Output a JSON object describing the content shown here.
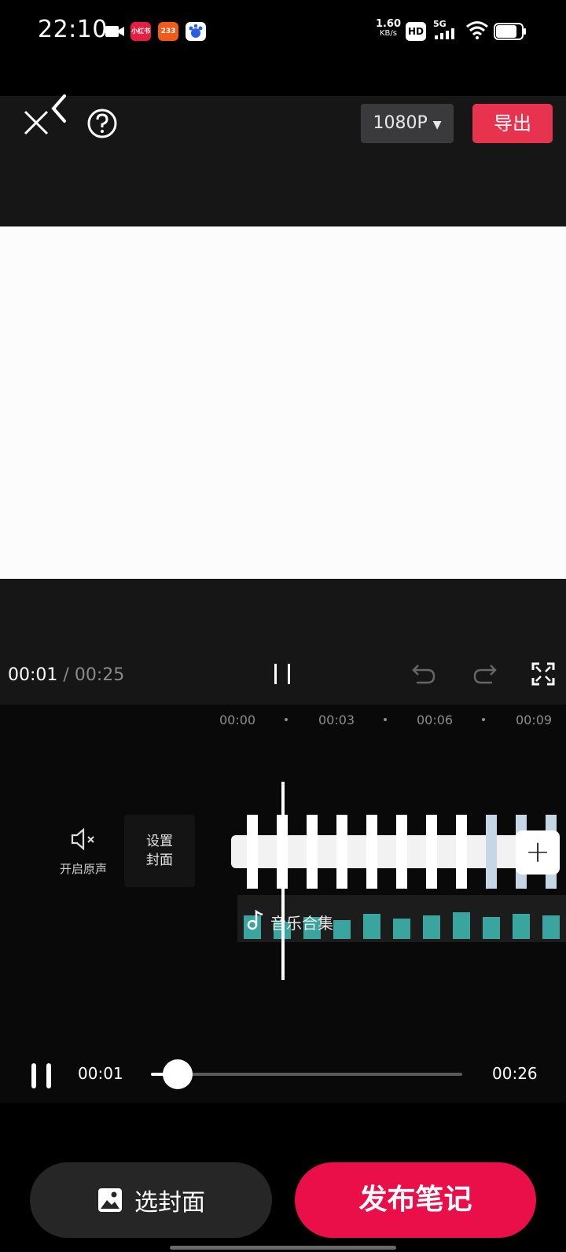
{
  "status_bar": {
    "time": "22:10",
    "net_speed_value": "1.60",
    "net_speed_unit": "KB/s",
    "hd_badge": "HD",
    "signal_label": "5G",
    "app_icons": [
      "camera-icon",
      "xiaohongshu-icon",
      "233-icon",
      "baidu-icon"
    ],
    "app_icon_texts": [
      "小红书",
      "233"
    ]
  },
  "toolbar": {
    "resolution_label": "1080P",
    "export_label": "导出"
  },
  "playback": {
    "current_time": "00:01",
    "separator": "/",
    "total_time": "00:25"
  },
  "timeline": {
    "ruler": [
      "00:00",
      "00:03",
      "00:06",
      "00:09"
    ],
    "mute_label": "开启原声",
    "cover_label_line1": "设置",
    "cover_label_line2": "封面",
    "audio_track_label": "音乐合集"
  },
  "player": {
    "current": "00:01",
    "duration": "00:26",
    "progress": 0.04
  },
  "bottom": {
    "choose_cover_label": "选封面",
    "publish_label": "发布笔记"
  },
  "colors": {
    "accent_red": "#e8334f",
    "publish_red": "#ea0f48",
    "waveform": "#3aa59e"
  }
}
